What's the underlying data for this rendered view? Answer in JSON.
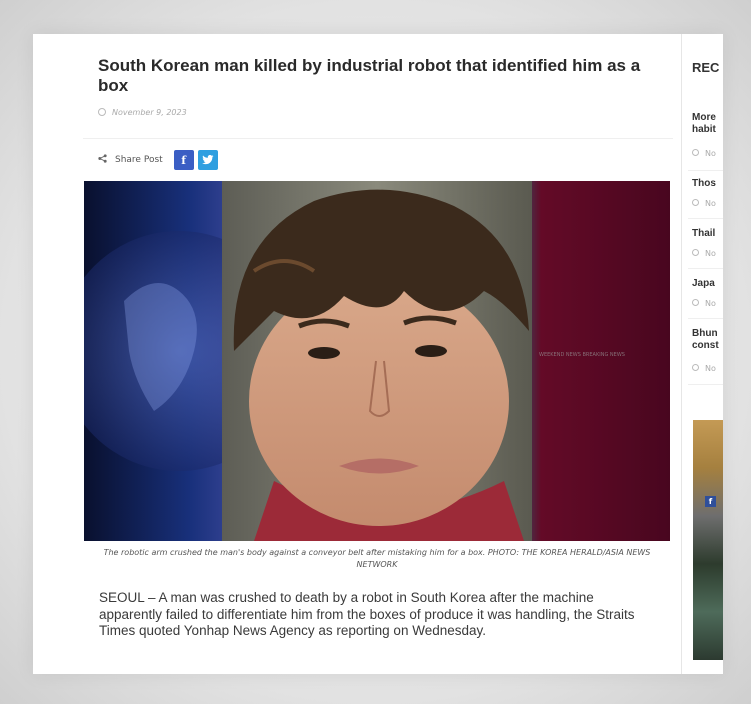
{
  "article": {
    "title": "South Korean man killed by industrial robot that identified him as a box",
    "date": "November 9, 2023",
    "share_label": "Share Post",
    "facebook_icon": "f",
    "photo_caption": "The robotic arm crushed the man's body against a conveyor belt after mistaking him for a box. PHOTO: THE KOREA HERALD/ASIA NEWS NETWORK",
    "photo_watermark": "WEEKEND NEWS BREAKING NEWS",
    "body": "SEOUL – A man was crushed to death by a robot in South Korea after the machine apparently failed to differentiate him from the boxes of produce it was handling, the Straits Times quoted Yonhap News Agency as reporting on Wednesday."
  },
  "sidebar": {
    "heading": "REC",
    "items": [
      {
        "title_line1": "More",
        "title_line2": "habit",
        "date": "No"
      },
      {
        "title_line1": "Thos",
        "title_line2": "",
        "date": "No"
      },
      {
        "title_line1": "Thail",
        "title_line2": "",
        "date": "No"
      },
      {
        "title_line1": "Japa",
        "title_line2": "",
        "date": "No"
      },
      {
        "title_line1": "Bhun",
        "title_line2": "const",
        "date": "No"
      }
    ],
    "ad_facebook_icon": "f"
  },
  "colors": {
    "facebook": "#3b5ec4",
    "twitter": "#2f9fe0",
    "title_text": "#2a2a2a",
    "meta_text": "#aaaaaa"
  }
}
